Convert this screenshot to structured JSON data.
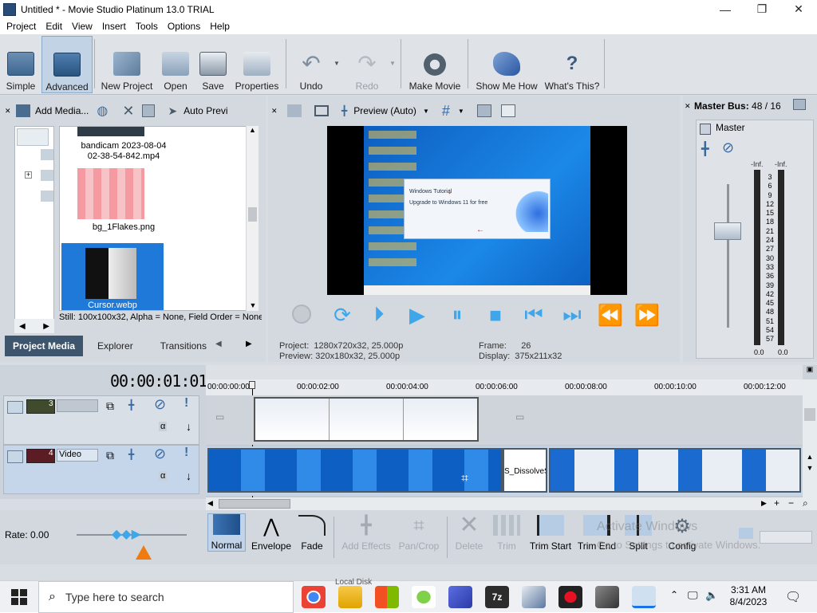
{
  "window": {
    "title": "Untitled * - Movie Studio Platinum 13.0 TRIAL",
    "minimize": "—",
    "maximize": "❐",
    "close": "✕"
  },
  "menu": [
    "Project",
    "Edit",
    "View",
    "Insert",
    "Tools",
    "Options",
    "Help"
  ],
  "toolbar": {
    "simple": "Simple",
    "advanced": "Advanced",
    "new_project": "New Project",
    "open": "Open",
    "save": "Save",
    "properties": "Properties",
    "undo": "Undo",
    "redo": "Redo",
    "make_movie": "Make Movie",
    "show_me_how": "Show Me How",
    "whats_this": "What's This?"
  },
  "media": {
    "add_media": "Add Media...",
    "auto_preview": "Auto Previ",
    "items": [
      {
        "name": "bandicam 2023-08-04\n02-38-54-842.mp4"
      },
      {
        "name": "bg_1Flakes.png"
      },
      {
        "name": "Cursor.webp"
      }
    ],
    "status": "Still: 100x100x32, Alpha = None, Field Order = None",
    "tabs": [
      "Project Media",
      "Explorer",
      "Transitions"
    ]
  },
  "preview": {
    "mode": "Preview (Auto)",
    "project_label": "Project:",
    "project_value": "1280x720x32, 25.000p",
    "preview_label": "Preview:",
    "preview_value": "320x180x32, 25.000p",
    "frame_label": "Frame:",
    "frame_value": "26",
    "display_label": "Display:",
    "display_value": "375x211x32",
    "popup_title": "Windows Tutorial",
    "popup_sub": "Upgrade to Windows 11 for free"
  },
  "master": {
    "title": "Master Bus:",
    "channels": "48 / 16",
    "label": "Master",
    "inf_left": "-Inf.",
    "inf_right": "-Inf.",
    "scale": [
      "3",
      "6",
      "9",
      "12",
      "15",
      "18",
      "21",
      "24",
      "27",
      "30",
      "33",
      "36",
      "39",
      "42",
      "45",
      "48",
      "51",
      "54",
      "57"
    ],
    "bottom_left": "0.0",
    "bottom_right": "0.0"
  },
  "timeline": {
    "timecode": "00:00:01:01",
    "ruler": [
      "00:00:00:00",
      "00:00:02:00",
      "00:00:04:00",
      "00:00:06:00",
      "00:00:08:00",
      "00:00:10:00",
      "00:00:12:00"
    ],
    "track1_num": "3",
    "track1_name": "",
    "track2_num": "4",
    "track2_name": "Video",
    "transition_label": "S_DissolveS",
    "rate": "Rate: 0.00"
  },
  "edit_tools": {
    "normal": "Normal",
    "envelope": "Envelope",
    "fade": "Fade",
    "add_effects": "Add Effects",
    "pan_crop": "Pan/Crop",
    "delete": "Delete",
    "trim": "Trim",
    "trim_start": "Trim Start",
    "trim_end": "Trim End",
    "split": "Split",
    "config": "Config",
    "watermark1": "Activate Windows",
    "watermark2": "Go to Settings to activate Windows."
  },
  "taskbar": {
    "search_placeholder": "Type here to search",
    "time": "3:31 AM",
    "date": "8/4/2023",
    "peek_text": "Local Disk"
  },
  "colors": {
    "accent": "#3fa6ea",
    "selected_tab": "#3d556d",
    "track_selected": "#c5d6ea",
    "desktop_blue": "#1569c7"
  }
}
